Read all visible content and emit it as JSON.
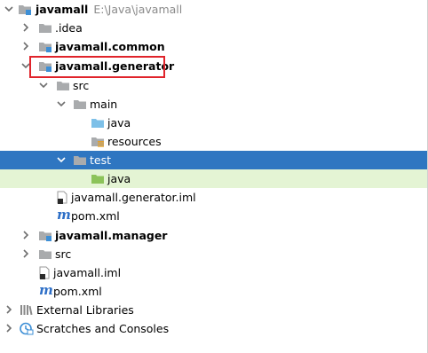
{
  "project": {
    "root_name": "javamall",
    "root_path": "E:\\Java\\javamall"
  },
  "tree": {
    "idea": ".idea",
    "common": "javamall.common",
    "generator": "javamall.generator",
    "gen_src": "src",
    "gen_main": "main",
    "gen_main_java": "java",
    "gen_resources": "resources",
    "gen_test": "test",
    "gen_test_java": "java",
    "gen_iml": "javamall.generator.iml",
    "gen_pom": "pom.xml",
    "manager": "javamall.manager",
    "root_src": "src",
    "root_iml": "javamall.iml",
    "root_pom": "pom.xml",
    "external_libraries": "External Libraries",
    "scratches": "Scratches and Consoles"
  },
  "pom_icon_glyph": "m",
  "colors": {
    "selection": "#2f76c1",
    "highlight": "#e4f4d4",
    "annotation_box": "#e0242b"
  },
  "icons": [
    "module-folder-icon",
    "folder-icon",
    "source-folder-icon",
    "resources-folder-icon",
    "test-folder-icon",
    "test-source-folder-icon",
    "iml-file-icon",
    "maven-pom-icon",
    "external-libraries-icon",
    "scratches-icon"
  ]
}
